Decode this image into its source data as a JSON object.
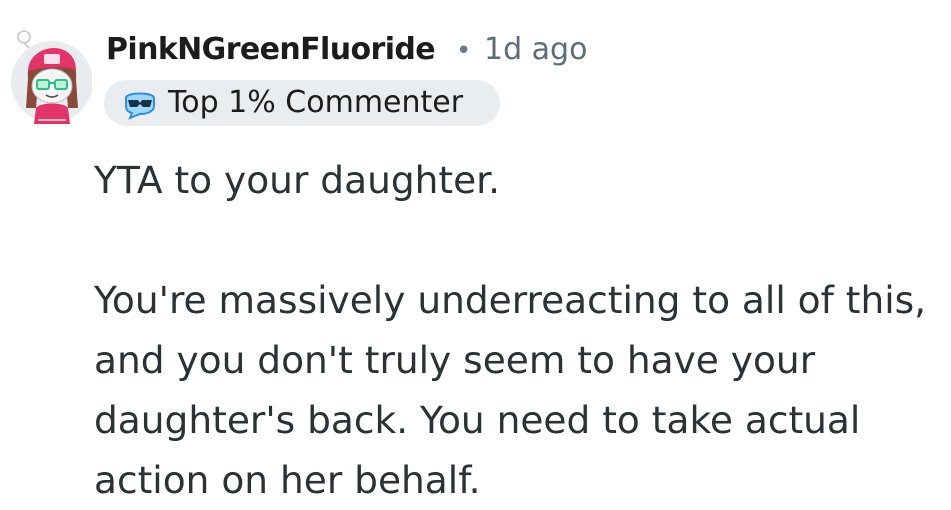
{
  "comment": {
    "author": "PinkNGreenFluoride",
    "separator": "•",
    "time": "1d ago",
    "flair": {
      "label": "Top 1% Commenter",
      "icon": "top-commenter-badge-icon"
    },
    "avatar_icon": "snoo-avatar-icon",
    "paragraphs": [
      [
        "YTA to your daughter."
      ],
      [
        "You're massively underreacting to all of this,",
        "and you don't truly seem to have your",
        "daughter's back. You need to take actual",
        "action on her behalf."
      ]
    ]
  },
  "colors": {
    "avatar_hat": "#e2336b",
    "avatar_hair": "#8a4a3a",
    "avatar_glasses": "#2fbf8a",
    "flair_bg": "#eaedef",
    "flair_icon": "#2f8fd8",
    "meta_text": "#5c6c79"
  }
}
